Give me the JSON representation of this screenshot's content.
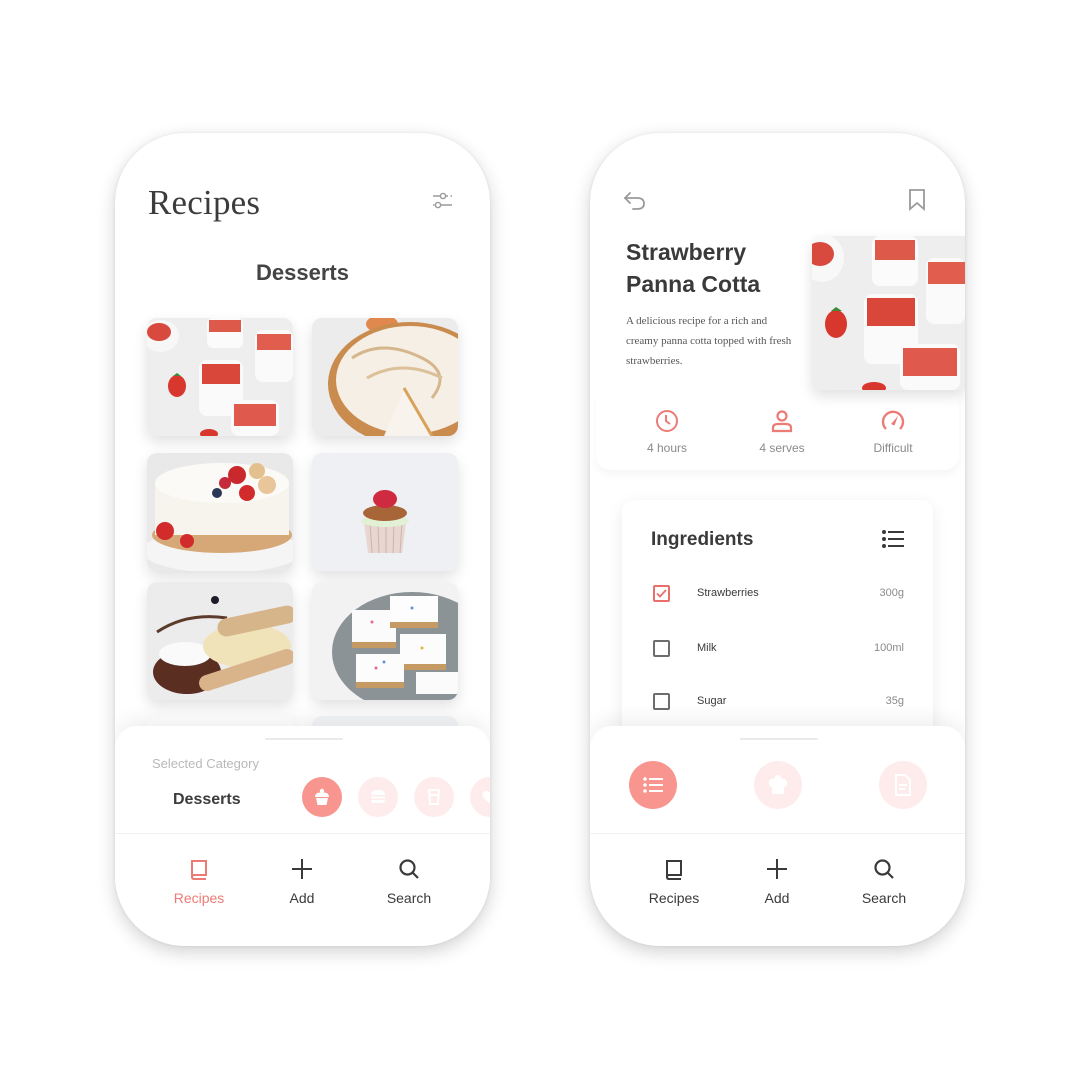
{
  "colors": {
    "accent": "#ec7b76",
    "accent_bg": "#f7958e",
    "accent_faded": "#fdeceb",
    "text_dark": "#3a3a3a",
    "text_muted": "#8a8a8a"
  },
  "left_screen": {
    "title": "Recipes",
    "filter_icon": "sliders-icon",
    "section_title": "Desserts",
    "grid": [
      {
        "name": "strawberry-panna-cotta",
        "icon": "photo"
      },
      {
        "name": "meringue-pie",
        "icon": "photo"
      },
      {
        "name": "berry-cheesecake",
        "icon": "photo"
      },
      {
        "name": "raspberry-cupcake",
        "icon": "photo"
      },
      {
        "name": "wafer-roll-brownie",
        "icon": "photo"
      },
      {
        "name": "sprinkle-bars",
        "icon": "photo"
      }
    ],
    "sheet": {
      "label": "Selected Category",
      "value": "Desserts",
      "categories": [
        {
          "name": "desserts",
          "icon": "cupcake-icon",
          "active": true
        },
        {
          "name": "burgers",
          "icon": "burger-icon",
          "active": false
        },
        {
          "name": "drinks",
          "icon": "glass-icon",
          "active": false
        },
        {
          "name": "other",
          "icon": "heart-icon",
          "active": false
        }
      ]
    },
    "tabs": [
      {
        "label": "Recipes",
        "icon": "book-icon",
        "active": true
      },
      {
        "label": "Add",
        "icon": "plus-icon",
        "active": false
      },
      {
        "label": "Search",
        "icon": "search-icon",
        "active": false
      }
    ]
  },
  "right_screen": {
    "title_line1": "Strawberry",
    "title_line2": "Panna Cotta",
    "description": "A delicious recipe for a rich and creamy panna cotta topped with fresh strawberries.",
    "stats": [
      {
        "label": "4 hours",
        "icon": "clock-icon"
      },
      {
        "label": "4 serves",
        "icon": "person-icon"
      },
      {
        "label": "Difficult",
        "icon": "gauge-icon"
      }
    ],
    "ingredients": {
      "title": "Ingredients",
      "items": [
        {
          "name": "Strawberries",
          "qty": "300g",
          "checked": true
        },
        {
          "name": "Milk",
          "qty": "100ml",
          "checked": false
        },
        {
          "name": "Sugar",
          "qty": "35g",
          "checked": false
        }
      ]
    },
    "sheet_buttons": [
      {
        "name": "ingredients",
        "icon": "list-icon",
        "active": true
      },
      {
        "name": "chef",
        "icon": "chef-hat-icon",
        "active": false
      },
      {
        "name": "instructions",
        "icon": "document-icon",
        "active": false
      }
    ],
    "tabs": [
      {
        "label": "Recipes",
        "icon": "book-icon",
        "active": false
      },
      {
        "label": "Add",
        "icon": "plus-icon",
        "active": false
      },
      {
        "label": "Search",
        "icon": "search-icon",
        "active": false
      }
    ]
  }
}
